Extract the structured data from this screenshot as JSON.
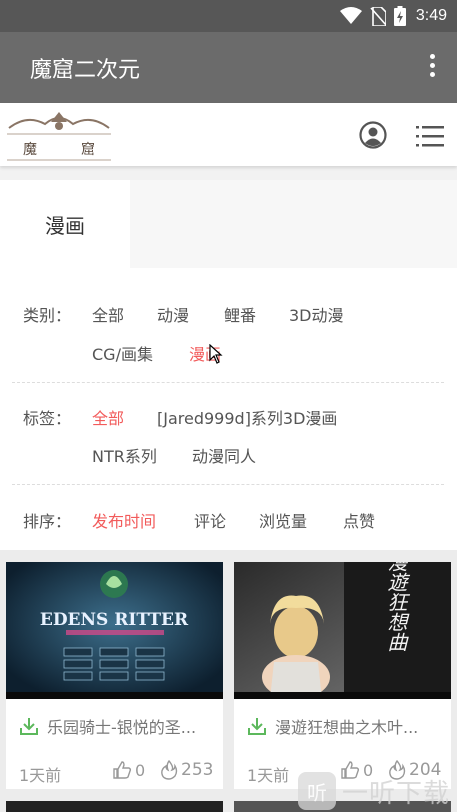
{
  "status_bar": {
    "time": "3:49"
  },
  "app_bar": {
    "title": "魔窟二次元"
  },
  "site_header": {
    "logo_text": "魔窟"
  },
  "tabs": [
    {
      "label": "漫画",
      "selected": true
    }
  ],
  "filters": {
    "category": {
      "label": "类别：",
      "options": [
        "全部",
        "动漫",
        "鲤番",
        "3D动漫",
        "CG/画集",
        "漫画"
      ],
      "active": "漫画"
    },
    "tag": {
      "label": "标签：",
      "options": [
        "全部",
        "[Jared999d]系列3D漫画",
        "NTR系列",
        "动漫同人"
      ],
      "active": "全部"
    },
    "sort": {
      "label": "排序：",
      "options": [
        "发布时间",
        "评论",
        "浏览量",
        "点赞"
      ],
      "active": "发布时间"
    }
  },
  "cards": [
    {
      "title": "乐园骑士-银悦的圣...",
      "time": "1天前",
      "likes": "0",
      "views": "253",
      "cover_text": "EDENS RITTER"
    },
    {
      "title": "漫遊狂想曲之木叶...",
      "time": "1天前",
      "likes": "0",
      "views": "204",
      "cover_text": "漫遊狂想曲"
    }
  ],
  "watermark": {
    "text": "一听下载",
    "badge": "听"
  },
  "colors": {
    "accent": "#f25b5b",
    "download_icon": "#5cb85c",
    "app_bar": "#6b6b6b",
    "status_bar": "#575757"
  }
}
